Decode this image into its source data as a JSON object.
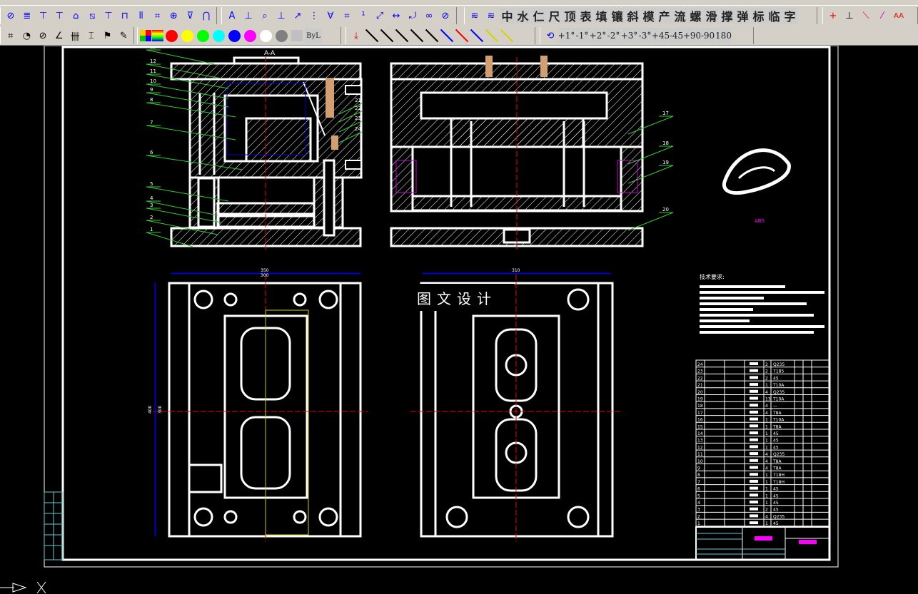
{
  "toolbar_row1_icons": [
    "hatch-icon",
    "spring-icon",
    "screw-icon",
    "t-bolt-icon",
    "pin-icon",
    "cross-hatch-icon",
    "ejector-icon",
    "sprue-icon",
    "guide-bush-icon",
    "lock-icon",
    "target-icon",
    "countersink-icon",
    "bushing-icon"
  ],
  "toolbar_row1_dim_icons": [
    "text-icon",
    "coord-dim-icon",
    "leader-icon",
    "linear-dim-icon",
    "angle-dim-icon",
    "ordinate-icon",
    "tolerance-icon",
    "datum-icon",
    "superscript-icon",
    "xy-label-icon",
    "dimension-icon",
    "balloon-icon",
    "ref-icon",
    "weld-icon"
  ],
  "cn_buttons": [
    "中",
    "水",
    "仁",
    "尺",
    "顶",
    "表",
    "填",
    "镶",
    "斜",
    "模",
    "产",
    "流",
    "螺",
    "滑",
    "撑",
    "弹",
    "标",
    "临",
    "字"
  ],
  "rotate_buttons": [
    "+1°",
    "-1°",
    "+2°",
    "-2°",
    "+3°",
    "-3°",
    "+45",
    "-45",
    "+90",
    "-90",
    "180"
  ],
  "color_labels": {
    "bylayer": "ByL"
  },
  "colors": [
    "#ff0000",
    "#ffff00",
    "#00ff00",
    "#00ffff",
    "#0000ff",
    "#ff00ff",
    "#ffffff",
    "#808080",
    "#c0c0c0"
  ],
  "line_colors": [
    "#000000",
    "#000000",
    "#000000",
    "#000000",
    "#000000",
    "#0000ff",
    "#ff0000",
    "#0000ff",
    "#d4d400",
    "#d4d400"
  ],
  "drawing": {
    "section_label": "A-A",
    "watermark": "图文设计",
    "part_material": "ABS",
    "tech_title": "技术要求:",
    "left_callouts": [
      "13",
      "12",
      "11",
      "10",
      "9",
      "8",
      "7",
      "6",
      "5",
      "4",
      "3",
      "2",
      "1"
    ],
    "right_callouts": [
      "21",
      "22",
      "23",
      "24"
    ],
    "view2_callouts": [
      "17",
      "18",
      "19",
      "20"
    ],
    "dims": {
      "width_top": "350",
      "width_top2": "300",
      "height_left": "400",
      "height_left2": "300",
      "width_right": "310"
    }
  },
  "bom": [
    {
      "no": "24",
      "qty": "2",
      "mat": "Q235"
    },
    {
      "no": "23",
      "qty": "2",
      "mat": "7185"
    },
    {
      "no": "22",
      "qty": "2",
      "mat": "45"
    },
    {
      "no": "21",
      "qty": "1",
      "mat": "T10A"
    },
    {
      "no": "20",
      "qty": "4",
      "mat": "Q235"
    },
    {
      "no": "19",
      "qty": "13",
      "mat": "T10A"
    },
    {
      "no": "18",
      "qty": "4",
      "mat": "—"
    },
    {
      "no": "17",
      "qty": "4",
      "mat": "T8A"
    },
    {
      "no": "16",
      "qty": "1",
      "mat": "T10A"
    },
    {
      "no": "15",
      "qty": "1",
      "mat": "T8A"
    },
    {
      "no": "14",
      "qty": "1",
      "mat": "45"
    },
    {
      "no": "13",
      "qty": "1",
      "mat": "45"
    },
    {
      "no": "12",
      "qty": "1",
      "mat": "45"
    },
    {
      "no": "11",
      "qty": "4",
      "mat": "Q235"
    },
    {
      "no": "10",
      "qty": "4",
      "mat": "T8A"
    },
    {
      "no": "9",
      "qty": "4",
      "mat": "T8A"
    },
    {
      "no": "8",
      "qty": "1",
      "mat": "718H"
    },
    {
      "no": "7",
      "qty": "1",
      "mat": "718H"
    },
    {
      "no": "6",
      "qty": "1",
      "mat": "45"
    },
    {
      "no": "5",
      "qty": "1",
      "mat": "45"
    },
    {
      "no": "4",
      "qty": "1",
      "mat": "45"
    },
    {
      "no": "3",
      "qty": "2",
      "mat": "45"
    },
    {
      "no": "2",
      "qty": "4",
      "mat": "Q235"
    },
    {
      "no": "1",
      "qty": "1",
      "mat": "45"
    }
  ]
}
